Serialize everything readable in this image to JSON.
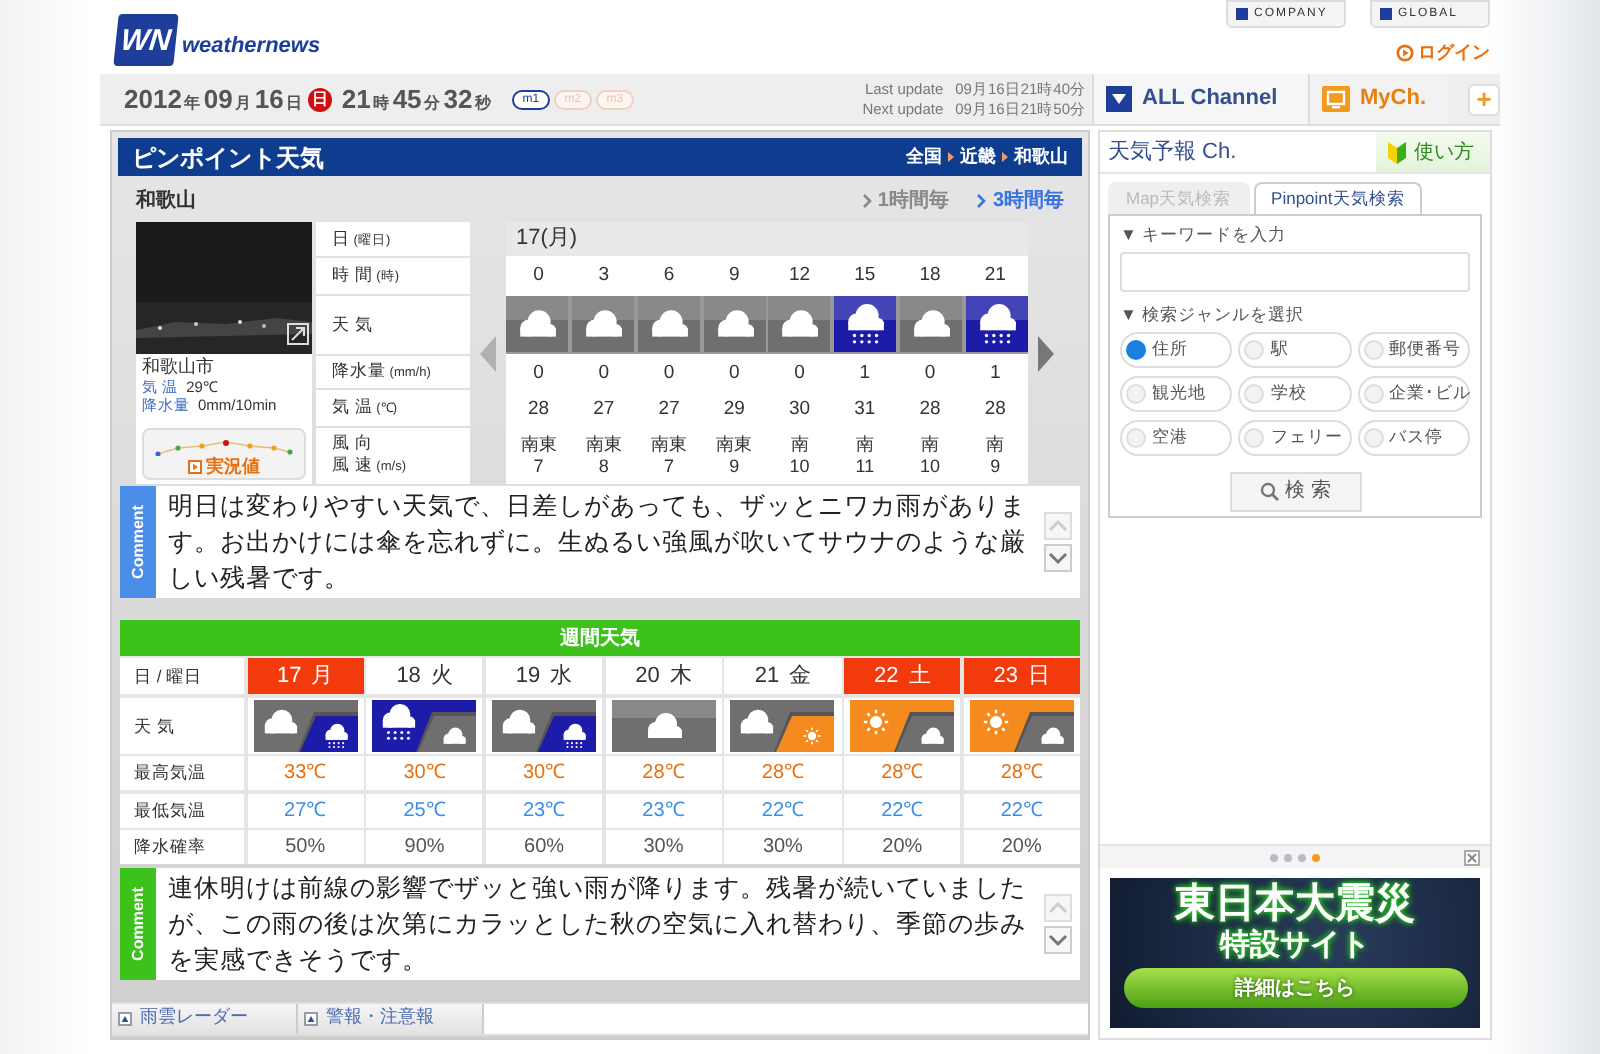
{
  "header": {
    "logo_mark": "WN",
    "logo_name": "weathernews",
    "links": [
      "COMPANY",
      "GLOBAL"
    ],
    "login": "ログイン"
  },
  "datebar": {
    "date": [
      {
        "text": "2012",
        "kind": "num"
      },
      {
        "text": "年",
        "kind": "unit"
      },
      {
        "text": "09",
        "kind": "num"
      },
      {
        "text": "月",
        "kind": "unit"
      },
      {
        "text": "16",
        "kind": "num"
      },
      {
        "text": "日",
        "kind": "unit"
      },
      {
        "text": "日",
        "kind": "badge"
      },
      {
        "text": "21",
        "kind": "num"
      },
      {
        "text": "時",
        "kind": "unit"
      },
      {
        "text": "45",
        "kind": "num"
      },
      {
        "text": "分",
        "kind": "unit"
      },
      {
        "text": "32",
        "kind": "num"
      },
      {
        "text": "秒",
        "kind": "unit"
      }
    ],
    "modes": [
      {
        "label": "m1",
        "selected": true
      },
      {
        "label": "m2",
        "selected": false
      },
      {
        "label": "m3",
        "selected": false
      }
    ],
    "updates": [
      {
        "label": "Last update",
        "value": "09月16日21時40分"
      },
      {
        "label": "Next update",
        "value": "09月16日21時50分"
      }
    ],
    "channels": [
      {
        "label": "ALL Channel",
        "kind": "all"
      },
      {
        "label": "MyCh.",
        "kind": "my"
      }
    ],
    "add": "+"
  },
  "pinpoint": {
    "title": "ピンポイント天気",
    "breadcrumb": [
      "全国",
      "近畿",
      "和歌山"
    ],
    "location": "和歌山",
    "intervals": [
      {
        "label": "1時間毎",
        "selected": false
      },
      {
        "label": "3時間毎",
        "selected": true
      }
    ],
    "camera": {
      "place": "和歌山市",
      "readings": [
        {
          "label": "気 温",
          "value": "29℃"
        },
        {
          "label": "降水量",
          "value": "0mm/10min"
        }
      ],
      "live": "実況値"
    },
    "row_labels": [
      {
        "label": "日",
        "unit": "(曜日)"
      },
      {
        "label": "時 間",
        "unit": "(時)"
      },
      {
        "label": "天 気"
      },
      {
        "label": "降水量",
        "unit": "(mm/h)"
      },
      {
        "label": "気 温",
        "unit": "(℃)"
      },
      {
        "label": "風 向",
        "label2": "風 速",
        "unit": "(m/s)"
      }
    ],
    "day": "17(月)",
    "hours": [
      {
        "time": "0",
        "icon": {
          "kind": "cloudy"
        },
        "precip": "0",
        "temp": "28",
        "wind_dir": "南東",
        "wind_speed": "7"
      },
      {
        "time": "3",
        "icon": {
          "kind": "cloudy"
        },
        "precip": "0",
        "temp": "27",
        "wind_dir": "南東",
        "wind_speed": "8"
      },
      {
        "time": "6",
        "icon": {
          "kind": "cloudy"
        },
        "precip": "0",
        "temp": "27",
        "wind_dir": "南東",
        "wind_speed": "7"
      },
      {
        "time": "9",
        "icon": {
          "kind": "cloudy"
        },
        "precip": "0",
        "temp": "29",
        "wind_dir": "南東",
        "wind_speed": "9"
      },
      {
        "time": "12",
        "icon": {
          "kind": "cloudy"
        },
        "precip": "0",
        "temp": "30",
        "wind_dir": "南",
        "wind_speed": "10"
      },
      {
        "time": "15",
        "icon": {
          "kind": "rain"
        },
        "precip": "1",
        "temp": "31",
        "wind_dir": "南",
        "wind_speed": "11"
      },
      {
        "time": "18",
        "icon": {
          "kind": "cloudy"
        },
        "precip": "0",
        "temp": "28",
        "wind_dir": "南",
        "wind_speed": "10"
      },
      {
        "time": "21",
        "icon": {
          "kind": "rain"
        },
        "precip": "1",
        "temp": "28",
        "wind_dir": "南",
        "wind_speed": "9"
      }
    ],
    "comment": {
      "label": "Comment",
      "text": "明日は変わりやすい天気で、日差しがあっても、ザッとニワカ雨があります。お出かけには傘を忘れずに。生ぬるい強風が吹いてサウナのような厳しい残暑です。"
    }
  },
  "weekly": {
    "title": "週間天気",
    "row_labels": [
      "日 / 曜日",
      "天 気",
      "最高気温",
      "最低気温",
      "降水確率"
    ],
    "days": [
      {
        "date": "17",
        "weekday": "月",
        "holiday": true,
        "icons": [
          {
            "kind": "cloudy"
          },
          {
            "kind": "rain"
          }
        ],
        "high": "33℃",
        "low": "27℃",
        "pop": "50%"
      },
      {
        "date": "18",
        "weekday": "火",
        "holiday": false,
        "icons": [
          {
            "kind": "rain"
          },
          {
            "kind": "cloudy"
          }
        ],
        "high": "30℃",
        "low": "25℃",
        "pop": "90%"
      },
      {
        "date": "19",
        "weekday": "水",
        "holiday": false,
        "icons": [
          {
            "kind": "cloudy"
          },
          {
            "kind": "rain"
          }
        ],
        "high": "30℃",
        "low": "23℃",
        "pop": "60%"
      },
      {
        "date": "20",
        "weekday": "木",
        "holiday": false,
        "icons": [
          {
            "kind": "cloudy"
          }
        ],
        "high": "28℃",
        "low": "23℃",
        "pop": "30%"
      },
      {
        "date": "21",
        "weekday": "金",
        "holiday": false,
        "icons": [
          {
            "kind": "cloudy"
          },
          {
            "kind": "sunny"
          }
        ],
        "high": "28℃",
        "low": "22℃",
        "pop": "30%"
      },
      {
        "date": "22",
        "weekday": "土",
        "holiday": true,
        "icons": [
          {
            "kind": "sunny"
          },
          {
            "kind": "cloudy"
          }
        ],
        "high": "28℃",
        "low": "22℃",
        "pop": "20%"
      },
      {
        "date": "23",
        "weekday": "日",
        "holiday": true,
        "icons": [
          {
            "kind": "sunny"
          },
          {
            "kind": "cloudy"
          }
        ],
        "high": "28℃",
        "low": "22℃",
        "pop": "20%"
      }
    ],
    "comment": {
      "label": "Comment",
      "text": "連休明けは前線の影響でザッと強い雨が降ります。残暑が続いていましたが、この雨の後は次第にカラッとした秋の空気に入れ替わり、季節の歩みを実感できそうです。"
    }
  },
  "bottom_tabs": [
    "雨雲レーダー",
    "警報・注意報"
  ],
  "sidebar": {
    "title": "天気予報 Ch.",
    "help": "使い方",
    "tabs": [
      {
        "label": "Map天気検索",
        "selected": false
      },
      {
        "label": "Pinpoint天気検索",
        "selected": true
      }
    ],
    "keyword_label": "▼ キーワードを入力",
    "genre_label": "▼ 検索ジャンルを選択",
    "genres": [
      {
        "label": "住所",
        "selected": true
      },
      {
        "label": "駅",
        "selected": false
      },
      {
        "label": "郵便番号",
        "selected": false
      },
      {
        "label": "観光地",
        "selected": false
      },
      {
        "label": "学校",
        "selected": false
      },
      {
        "label": "企業･ビル",
        "selected": false
      },
      {
        "label": "空港",
        "selected": false
      },
      {
        "label": "フェリー",
        "selected": false
      },
      {
        "label": "バス停",
        "selected": false
      }
    ],
    "search": "検 索",
    "dots": [
      {
        "selected": false
      },
      {
        "selected": false
      },
      {
        "selected": false
      },
      {
        "selected": true
      }
    ],
    "banner": {
      "line1": "東日本大震災",
      "line2": "特設サイト",
      "button": "詳細はこちら"
    }
  }
}
